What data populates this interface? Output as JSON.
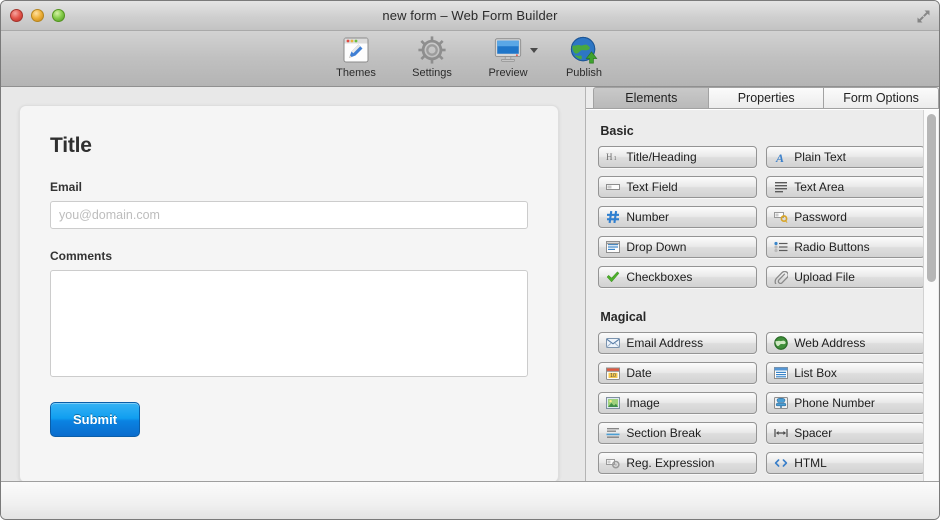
{
  "window": {
    "title": "new form – Web Form Builder",
    "controls": {
      "close": "close",
      "minimize": "minimize",
      "maximize": "maximize",
      "fullscreen": "fullscreen-arrows-icon"
    }
  },
  "toolbar": {
    "items": [
      {
        "label": "Themes",
        "icon": "themes-palette-icon",
        "has_menu": false
      },
      {
        "label": "Settings",
        "icon": "gear-icon",
        "has_menu": false
      },
      {
        "label": "Preview",
        "icon": "monitor-icon",
        "has_menu": true
      },
      {
        "label": "Publish",
        "icon": "globe-upload-icon",
        "has_menu": false
      }
    ]
  },
  "canvas": {
    "form": {
      "title": "Title",
      "fields": [
        {
          "label": "Email",
          "type": "text",
          "value": "",
          "placeholder": "you@domain.com"
        },
        {
          "label": "Comments",
          "type": "textarea",
          "value": "",
          "placeholder": ""
        }
      ],
      "submit_label": "Submit"
    }
  },
  "inspector": {
    "tabs": [
      {
        "label": "Elements",
        "active": true
      },
      {
        "label": "Properties",
        "active": false
      },
      {
        "label": "Form Options",
        "active": false
      }
    ],
    "groups": [
      {
        "title": "Basic",
        "items": [
          {
            "label": "Title/Heading",
            "icon": "heading-h1-icon"
          },
          {
            "label": "Plain Text",
            "icon": "italic-a-icon"
          },
          {
            "label": "Text Field",
            "icon": "text-field-icon"
          },
          {
            "label": "Text Area",
            "icon": "text-area-icon"
          },
          {
            "label": "Number",
            "icon": "hash-number-icon"
          },
          {
            "label": "Password",
            "icon": "key-password-icon"
          },
          {
            "label": "Drop Down",
            "icon": "drop-down-icon"
          },
          {
            "label": "Radio Buttons",
            "icon": "radio-buttons-icon"
          },
          {
            "label": "Checkboxes",
            "icon": "green-check-icon"
          },
          {
            "label": "Upload File",
            "icon": "paperclip-icon"
          }
        ]
      },
      {
        "title": "Magical",
        "items": [
          {
            "label": "Email Address",
            "icon": "envelope-icon"
          },
          {
            "label": "Web Address",
            "icon": "globe-icon"
          },
          {
            "label": "Date",
            "icon": "calendar-icon"
          },
          {
            "label": "List Box",
            "icon": "list-box-icon"
          },
          {
            "label": "Image",
            "icon": "image-icon"
          },
          {
            "label": "Phone Number",
            "icon": "telephone-icon"
          },
          {
            "label": "Section Break",
            "icon": "section-break-icon"
          },
          {
            "label": "Spacer",
            "icon": "spacer-arrows-icon"
          },
          {
            "label": "Reg. Expression",
            "icon": "reg-expression-icon"
          },
          {
            "label": "HTML",
            "icon": "angle-brackets-icon"
          }
        ]
      }
    ]
  },
  "colors": {
    "submit_blue_top": "#36b3f4",
    "submit_blue_bottom": "#0a6ccd",
    "accent_icon_blue": "#2f7fd0",
    "check_green": "#4caf2a",
    "window_chrome": "#ececec"
  },
  "statusbar": {
    "text": ""
  }
}
